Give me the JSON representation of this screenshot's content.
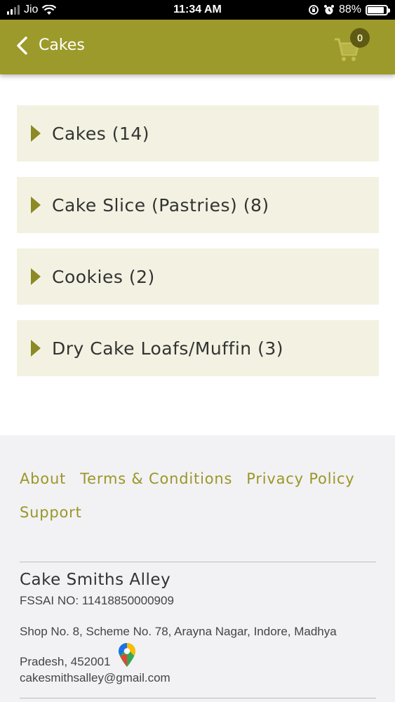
{
  "status_bar": {
    "carrier": "Jio",
    "time": "11:34 AM",
    "battery": "88%",
    "battery_level": 0.88
  },
  "header": {
    "title": "Cakes",
    "cart_count": "0",
    "back_icon": "chevron-left-icon",
    "cart_icon": "cart-icon"
  },
  "categories": [
    {
      "label": "Cakes (14)"
    },
    {
      "label": "Cake Slice (Pastries) (8)"
    },
    {
      "label": "Cookies (2)"
    },
    {
      "label": "Dry Cake Loafs/Muffin (3)"
    }
  ],
  "footer": {
    "links": {
      "about": "About",
      "terms": "Terms & Conditions",
      "privacy": "Privacy Policy",
      "support": "Support"
    },
    "shop_name": "Cake Smiths Alley",
    "fssai": "FSSAI NO: 11418850000909",
    "address": "Shop No. 8, Scheme No. 78, Arayna Nagar, Indore, Madhya Pradesh, 452001",
    "email": "cakesmithsalley@gmail.com",
    "map_icon": "map-pin-icon"
  },
  "colors": {
    "header_bg": "#9c9a2a",
    "category_bg": "#f3f2e2",
    "link": "#9a9728",
    "footer_bg": "#f2f2f4"
  }
}
